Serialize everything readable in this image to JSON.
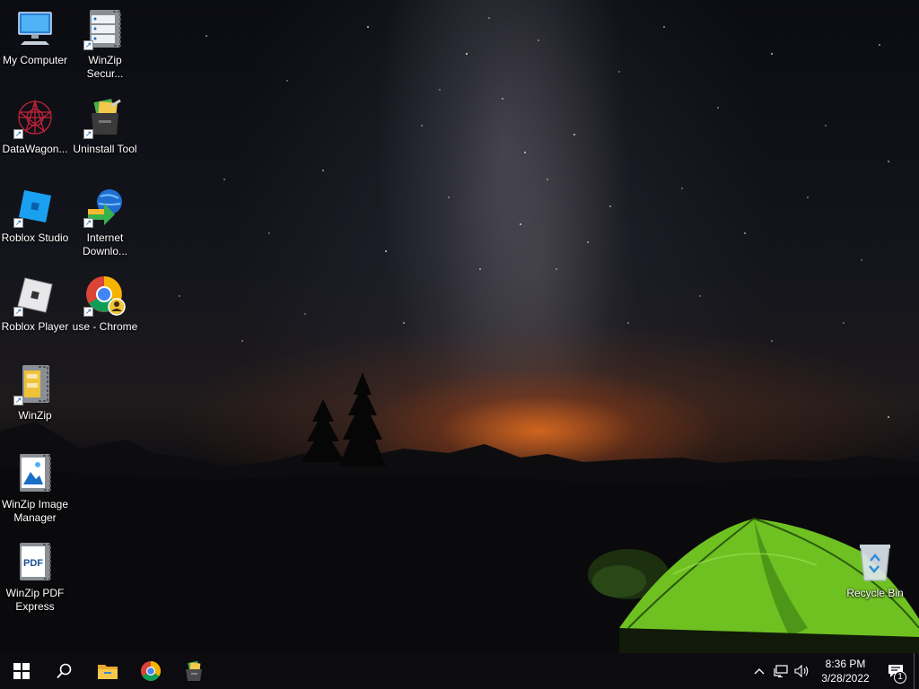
{
  "desktop": {
    "icons": [
      {
        "label": "My Computer",
        "icon": "computer-icon"
      },
      {
        "label": "WinZip Secur...",
        "icon": "winzip-secure-icon"
      },
      {
        "label": "DataWagon...",
        "icon": "datawagon-icon"
      },
      {
        "label": "Uninstall Tool",
        "icon": "uninstall-tool-icon"
      },
      {
        "label": "Roblox Studio",
        "icon": "roblox-studio-icon"
      },
      {
        "label": "Internet Downlo...",
        "icon": "internet-download-manager-icon"
      },
      {
        "label": "Roblox Player",
        "icon": "roblox-player-icon"
      },
      {
        "label": "use - Chrome",
        "icon": "chrome-profile-icon"
      },
      {
        "label": "WinZip",
        "icon": "winzip-icon"
      },
      {
        "label": "WinZip Image Manager",
        "icon": "winzip-image-manager-icon"
      },
      {
        "label": "WinZip PDF Express",
        "icon": "winzip-pdf-express-icon"
      },
      {
        "label": "Recycle Bin",
        "icon": "recycle-bin-icon"
      }
    ]
  },
  "taskbar": {
    "start": "start-icon",
    "search": "search-icon",
    "pinned": [
      "file-explorer-icon",
      "chrome-icon",
      "uninstall-tool-icon"
    ],
    "tray": {
      "chevron": "^",
      "network": "network-icon",
      "volume": "volume-icon",
      "time": "8:36 PM",
      "date": "3/28/2022",
      "notification_count": "1"
    }
  },
  "colors": {
    "taskbar_bg": "#0c0c10",
    "tent_green": "#7fd12a",
    "horizon_orange": "#e66e1e"
  }
}
